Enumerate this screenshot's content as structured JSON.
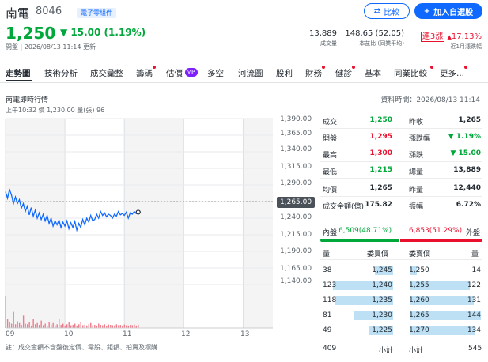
{
  "stock": {
    "name": "南電",
    "code": "8046",
    "tag": "電子零組件",
    "price": "1,250",
    "change": "15.00 (1.19%)",
    "time_info": "開盤 | 2026/08/13 11:14 更新",
    "colors": {
      "up": "#e9112e",
      "down": "#00a73a",
      "accent": "#0f69ff"
    }
  },
  "header_stats": [
    {
      "value": "13,889",
      "label": "成交量"
    },
    {
      "value": "148.65 (52.05)",
      "label": "本益比 (同業平均)"
    },
    {
      "value": "連3漲",
      "value2": "17.13%",
      "label": "近1月漲跌幅"
    }
  ],
  "buttons": {
    "compare": "比較",
    "add_watchlist": "加入自選股"
  },
  "tabs": [
    "走勢圖",
    "技術分析",
    "成交彙整",
    "籌碼",
    "估價",
    "多空",
    "河流圖",
    "股利",
    "財務",
    "健診",
    "基本",
    "同業比較",
    "更多..."
  ],
  "vip_badge": "VIP",
  "chart": {
    "title": "南電即時行情",
    "data_time": "資料時間：2026/08/13 11:14",
    "sub_info": "上午10:32 價 1,230.00 量(張) 96",
    "current_price_label": "1,265.00",
    "note": "註：成交金額不含盤後定價、零股、鉅額、拍賣及標購"
  },
  "chart_data": {
    "type": "line",
    "y_ticks": [
      "1,390.00",
      "1,365.00",
      "1,340.00",
      "1,315.00",
      "1,290.00",
      "1,265.00",
      "1,240.00",
      "1,215.00",
      "1,190.00",
      "1,165.00",
      "1,140.00"
    ],
    "x_ticks": [
      "09",
      "10",
      "11",
      "12",
      "13"
    ],
    "ylim": [
      1140,
      1390
    ],
    "reference": 1265,
    "x": [
      0,
      2,
      4,
      6,
      8,
      10,
      12,
      14,
      16,
      18,
      20,
      22,
      24,
      26,
      28,
      30,
      32,
      34,
      36,
      38,
      40,
      42,
      44,
      46,
      48,
      50,
      52,
      54,
      56,
      58,
      60,
      62,
      64,
      66,
      68,
      70,
      72,
      74,
      76,
      78,
      80,
      82,
      84,
      86,
      88,
      90,
      92,
      94,
      96,
      98,
      100,
      102,
      104,
      106,
      108,
      110,
      112,
      114,
      116,
      118,
      120,
      122,
      124,
      126,
      128,
      130,
      132,
      134
    ],
    "values": [
      1280,
      1270,
      1283,
      1275,
      1262,
      1272,
      1262,
      1268,
      1255,
      1262,
      1250,
      1258,
      1245,
      1256,
      1243,
      1252,
      1240,
      1248,
      1238,
      1246,
      1236,
      1244,
      1232,
      1240,
      1228,
      1236,
      1230,
      1237,
      1226,
      1234,
      1228,
      1236,
      1224,
      1233,
      1226,
      1235,
      1222,
      1232,
      1226,
      1238,
      1230,
      1240,
      1234,
      1244,
      1236,
      1238,
      1246,
      1240,
      1250,
      1244,
      1248,
      1242,
      1246,
      1244,
      1240,
      1246,
      1243,
      1250,
      1245,
      1247,
      1244,
      1249,
      1240,
      1248,
      1246,
      1250,
      1247,
      1249
    ],
    "volume_max": 600,
    "volumes": [
      520,
      140,
      90,
      70,
      260,
      60,
      110,
      80,
      50,
      200,
      70,
      60,
      90,
      40,
      150,
      60,
      80,
      50,
      120,
      45,
      70,
      40,
      100,
      55,
      80,
      45,
      60,
      140,
      50,
      70,
      40,
      60,
      90,
      45,
      50,
      70,
      40,
      60,
      100,
      45,
      55,
      40,
      60,
      80,
      45,
      50,
      40,
      70,
      50,
      45,
      60,
      40,
      55,
      50,
      45,
      40,
      60,
      45,
      50,
      40,
      55,
      45,
      40,
      50,
      45,
      55,
      40,
      50
    ]
  },
  "quote": {
    "left": [
      {
        "label": "成交",
        "value": "1,250",
        "color": "green"
      },
      {
        "label": "開盤",
        "value": "1,295",
        "color": "red"
      },
      {
        "label": "最高",
        "value": "1,300",
        "color": "red"
      },
      {
        "label": "最低",
        "value": "1,215",
        "color": "green"
      },
      {
        "label": "均價",
        "value": "1,265",
        "color": "none"
      },
      {
        "label": "成交金額(億)",
        "value": "175.82",
        "color": "none"
      }
    ],
    "right": [
      {
        "label": "昨收",
        "value": "1,265",
        "color": "none"
      },
      {
        "label": "漲跌幅",
        "value": "▼ 1.19%",
        "color": "green"
      },
      {
        "label": "漲跌",
        "value": "▼ 15.00",
        "color": "green"
      },
      {
        "label": "總量",
        "value": "13,889",
        "color": "none"
      },
      {
        "label": "昨量",
        "value": "12,440",
        "color": "none"
      },
      {
        "label": "振幅",
        "value": "6.72%",
        "color": "none"
      }
    ]
  },
  "pressure": {
    "in_label": "內盤",
    "in_value": "6,509(48.71%)",
    "out_value": "6,853(51.29%)",
    "out_label": "外盤",
    "in_fraction": 0.4871
  },
  "orderbook": {
    "headers": {
      "qty": "量",
      "bid": "委買價",
      "ask": "委賣價",
      "qty2": "量"
    },
    "bids": [
      {
        "qty": "38",
        "price": "1,245",
        "fill": 0.26
      },
      {
        "qty": "123",
        "price": "1,240",
        "fill": 0.85
      },
      {
        "qty": "118",
        "price": "1,235",
        "fill": 0.81
      },
      {
        "qty": "81",
        "price": "1,230",
        "fill": 0.56
      },
      {
        "qty": "49",
        "price": "1,225",
        "fill": 0.34
      }
    ],
    "asks": [
      {
        "price": "1,250",
        "qty": "14",
        "fill": 0.1
      },
      {
        "price": "1,255",
        "qty": "122",
        "fill": 0.84
      },
      {
        "price": "1,260",
        "qty": "131",
        "fill": 0.9
      },
      {
        "price": "1,265",
        "qty": "144",
        "fill": 1.0
      },
      {
        "price": "1,270",
        "qty": "134",
        "fill": 0.92
      }
    ],
    "footer": {
      "bid_total": "409",
      "bid_label": "小計",
      "ask_label": "小計",
      "ask_total": "545"
    }
  }
}
